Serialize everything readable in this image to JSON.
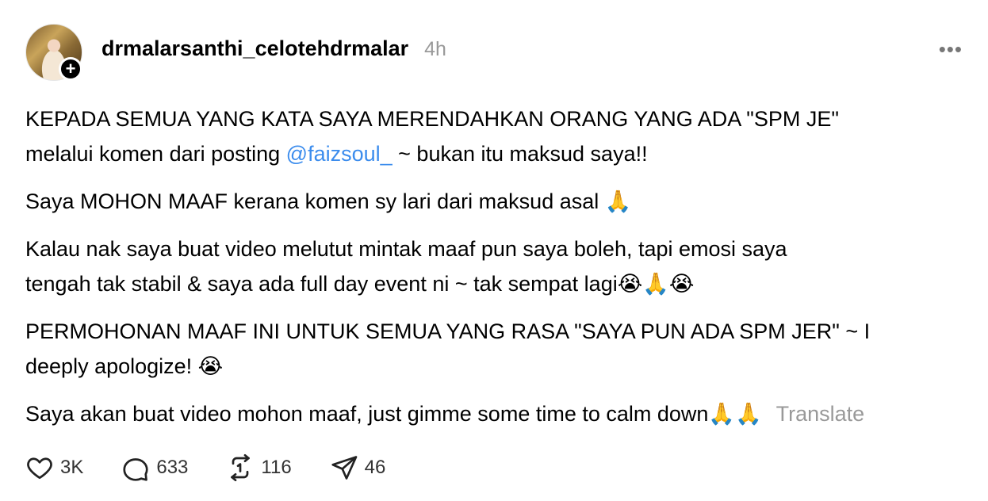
{
  "post": {
    "username": "drmalarsanthi_celotehdrmalar",
    "time": "4h",
    "follow_symbol": "+",
    "more_symbol": "•••",
    "paragraphs": {
      "p1_a": "KEPADA SEMUA YANG KATA SAYA MERENDAHKAN ORANG YANG ADA \"SPM JE\"",
      "p1_b": "melalui komen dari posting ",
      "p1_mention": "@faizsoul_",
      "p1_c": " ~ bukan itu maksud saya!!",
      "p2": "Saya MOHON MAAF kerana komen sy lari dari maksud asal 🙏",
      "p3_a": "Kalau nak saya buat video melutut mintak maaf pun saya boleh, tapi emosi saya",
      "p3_b": "tengah tak stabil & saya ada full day event ni ~ tak sempat lagi😭🙏😭",
      "p4_a": "PERMOHONAN MAAF INI UNTUK SEMUA YANG RASA \"SAYA PUN ADA SPM JER\" ~ I",
      "p4_b": "deeply apologize! 😭",
      "p5": "Saya akan buat video mohon maaf, just gimme some time to calm down🙏🙏"
    },
    "translate_label": "Translate"
  },
  "actions": {
    "like_count": "3K",
    "comment_count": "633",
    "repost_count": "116",
    "share_count": "46"
  },
  "icons": {
    "like": "heart-icon",
    "comment": "comment-bubble-icon",
    "repost": "repost-icon",
    "share": "send-icon"
  }
}
